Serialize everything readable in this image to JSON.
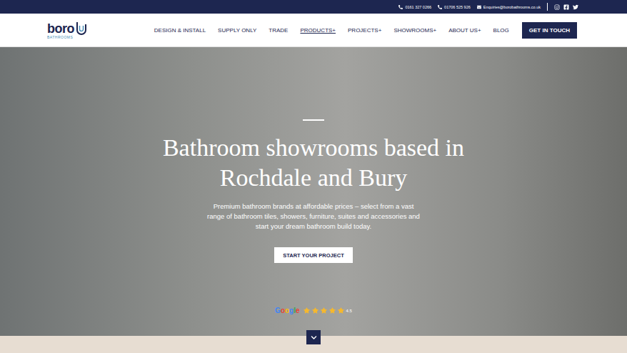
{
  "top_bar": {
    "contacts": [
      {
        "kind": "phone",
        "text": "0161 327 0266"
      },
      {
        "kind": "phone",
        "text": "01706 525 926"
      },
      {
        "kind": "email",
        "text": "Enquiries@borobathrooms.co.uk"
      }
    ],
    "social": [
      {
        "kind": "instagram"
      },
      {
        "kind": "facebook"
      },
      {
        "kind": "twitter"
      }
    ]
  },
  "logo": {
    "name": "boro",
    "sub": "BATHROOMS"
  },
  "nav": {
    "items": [
      {
        "label": "DESIGN & INSTALL",
        "selected": false
      },
      {
        "label": "SUPPLY ONLY",
        "selected": false
      },
      {
        "label": "TRADE",
        "selected": false
      },
      {
        "label": "PRODUCTS+",
        "selected": true
      },
      {
        "label": "PROJECTS+",
        "selected": false
      },
      {
        "label": "SHOWROOMS+",
        "selected": false
      },
      {
        "label": "ABOUT US+",
        "selected": false
      },
      {
        "label": "BLOG",
        "selected": false
      }
    ],
    "button": "GET IN TOUCH"
  },
  "hero": {
    "heading": "Bathroom showrooms based in Rochdale and Bury",
    "paragraph": "Premium bathroom brands at affordable prices – select from a vast range of bathroom tiles, showers, furniture, suites and accessories and start your dream bathroom build today.",
    "button": "START YOUR PROJECT",
    "rating": {
      "brand": "Google",
      "stars": 5,
      "score": "4.5"
    }
  }
}
